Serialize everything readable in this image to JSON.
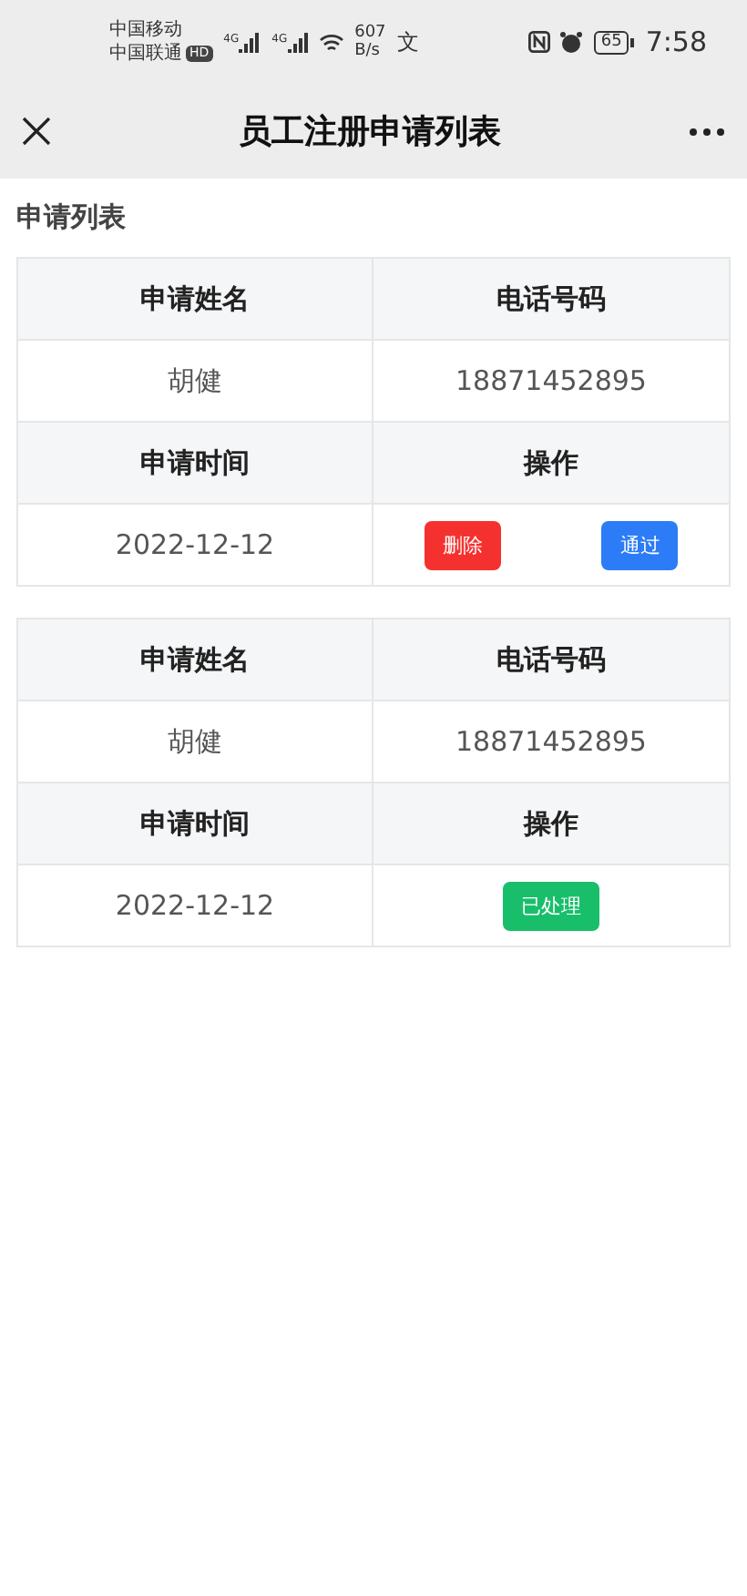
{
  "status_bar": {
    "carriers": [
      "中国移动",
      "中国联通"
    ],
    "hd": "HD",
    "network": [
      "4G",
      "4G"
    ],
    "speed": "607",
    "speed_unit": "B/s",
    "ime": "文",
    "battery": "65",
    "time": "7:58"
  },
  "nav": {
    "title": "员工注册申请列表"
  },
  "section_title": "申请列表",
  "records": [
    {
      "headers": [
        "申请姓名",
        "电话号码",
        "申请时间",
        "操作"
      ],
      "name": "胡健",
      "phone": "18871452895",
      "date": "2022-12-12",
      "actions": [
        {
          "label": "删除",
          "kind": "delete"
        },
        {
          "label": "通过",
          "kind": "approve"
        }
      ]
    },
    {
      "headers": [
        "申请姓名",
        "电话号码",
        "申请时间",
        "操作"
      ],
      "name": "胡健",
      "phone": "18871452895",
      "date": "2022-12-12",
      "actions": [
        {
          "label": "已处理",
          "kind": "done"
        }
      ]
    }
  ]
}
